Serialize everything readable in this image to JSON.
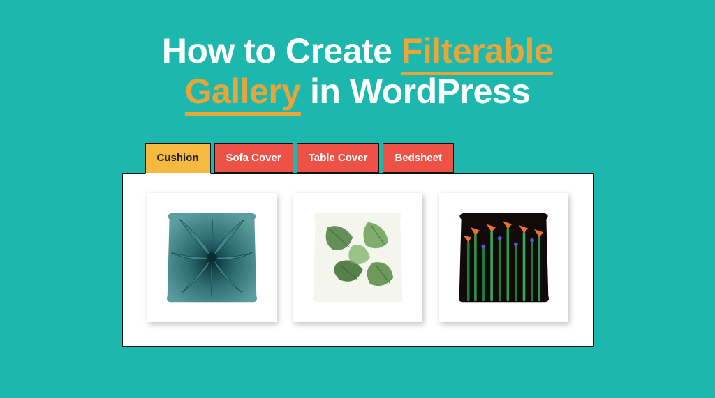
{
  "headline": {
    "part1": "How to Create ",
    "highlight1": "Filterable",
    "part2": "Gallery",
    "part3": " in WordPress"
  },
  "tabs": [
    {
      "label": "Cushion",
      "active": true
    },
    {
      "label": "Sofa Cover",
      "active": false
    },
    {
      "label": "Table Cover",
      "active": false
    },
    {
      "label": "Bedsheet",
      "active": false
    }
  ],
  "gallery": {
    "items": [
      {
        "name": "cushion-agave-teal"
      },
      {
        "name": "cushion-tropical-leaves"
      },
      {
        "name": "cushion-bird-of-paradise-dark"
      }
    ]
  }
}
